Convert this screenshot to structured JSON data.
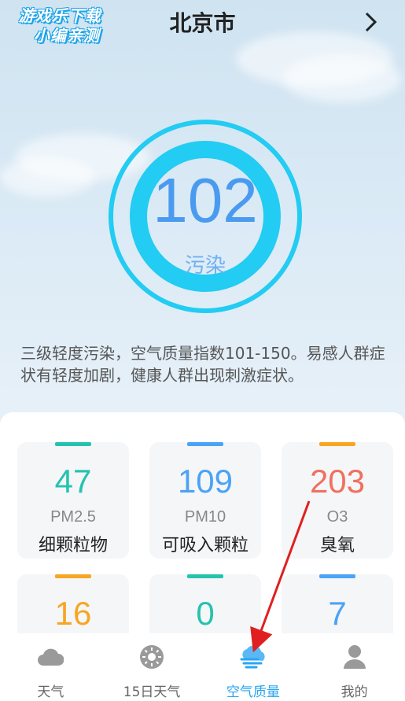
{
  "watermark": {
    "line1": "游戏乐下载",
    "line2": "小编亲测"
  },
  "header": {
    "city": "北京市"
  },
  "aqi": {
    "value": "102",
    "level": "污染",
    "description": "三级轻度污染，空气质量指数101-150。易感人群症状有轻度加剧，健康人群出现刺激症状。"
  },
  "pollutants": [
    {
      "value": "47",
      "code": "PM2.5",
      "name": "细颗粒物",
      "accent": "#26c2b0",
      "value_color": "#26c2b0"
    },
    {
      "value": "109",
      "code": "PM10",
      "name": "可吸入颗粒",
      "accent": "#4aa3f5",
      "value_color": "#4aa3f5"
    },
    {
      "value": "203",
      "code": "O3",
      "name": "臭氧",
      "accent": "#f6a623",
      "value_color": "#f07060"
    },
    {
      "value": "16",
      "code": "",
      "name": "",
      "accent": "#f6a623",
      "value_color": "#f6a623"
    },
    {
      "value": "0",
      "code": "",
      "name": "",
      "accent": "#26c2b0",
      "value_color": "#26c2b0"
    },
    {
      "value": "7",
      "code": "",
      "name": "",
      "accent": "#4aa3f5",
      "value_color": "#4aa3f5"
    }
  ],
  "tabs": [
    {
      "label": "天气",
      "icon": "cloud-icon"
    },
    {
      "label": "15日天气",
      "icon": "sun-icon"
    },
    {
      "label": "空气质量",
      "icon": "wind-cloud-icon",
      "active": true
    },
    {
      "label": "我的",
      "icon": "person-icon"
    }
  ],
  "colors": {
    "gauge": "#22ccf2",
    "accent_active": "#2aa6f2",
    "annotation_arrow": "#e02020"
  }
}
